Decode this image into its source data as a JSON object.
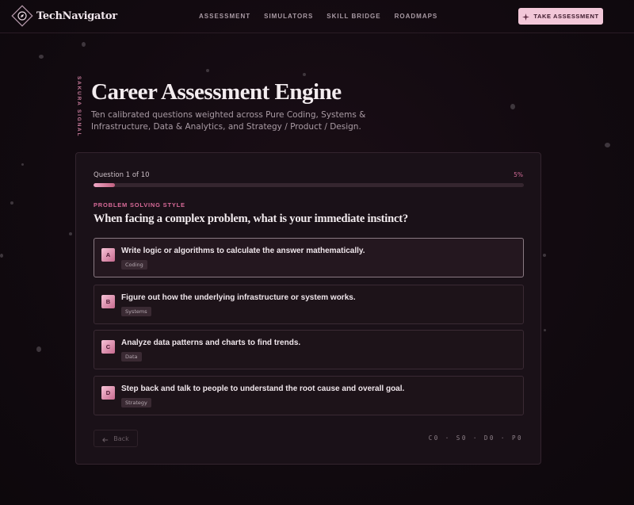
{
  "brand": {
    "name": "TechNavigator"
  },
  "nav": {
    "items": [
      "ASSESSMENT",
      "SIMULATORS",
      "SKILL BRIDGE",
      "ROADMAPS"
    ]
  },
  "cta": {
    "label": "TAKE ASSESSMENT",
    "icon": "sparkle-icon"
  },
  "hero": {
    "side_label": "SAKURA SIGNAL",
    "title": "Career Assessment Engine",
    "subtitle": "Ten calibrated questions weighted across Pure Coding, Systems & Infrastructure, Data & Analytics, and Strategy / Product / Design."
  },
  "quiz": {
    "counter": "Question 1 of 10",
    "percent_label": "5%",
    "progress": 0.05,
    "category": "PROBLEM SOLVING STYLE",
    "question": "When facing a complex problem, what is your immediate instinct?",
    "options": [
      {
        "letter": "A",
        "text": "Write logic or algorithms to calculate the answer mathematically.",
        "tag": "Coding"
      },
      {
        "letter": "B",
        "text": "Figure out how the underlying infrastructure or system works.",
        "tag": "Systems"
      },
      {
        "letter": "C",
        "text": "Analyze data patterns and charts to find trends.",
        "tag": "Data"
      },
      {
        "letter": "D",
        "text": "Step back and talk to people to understand the root cause and overall goal.",
        "tag": "Strategy"
      }
    ],
    "back_label": "Back",
    "score_code": "C0 · S0 · D0 · P0"
  },
  "colors": {
    "accent": "#f2c7d8",
    "accent_text": "#d86a98",
    "background": "#120a10"
  }
}
